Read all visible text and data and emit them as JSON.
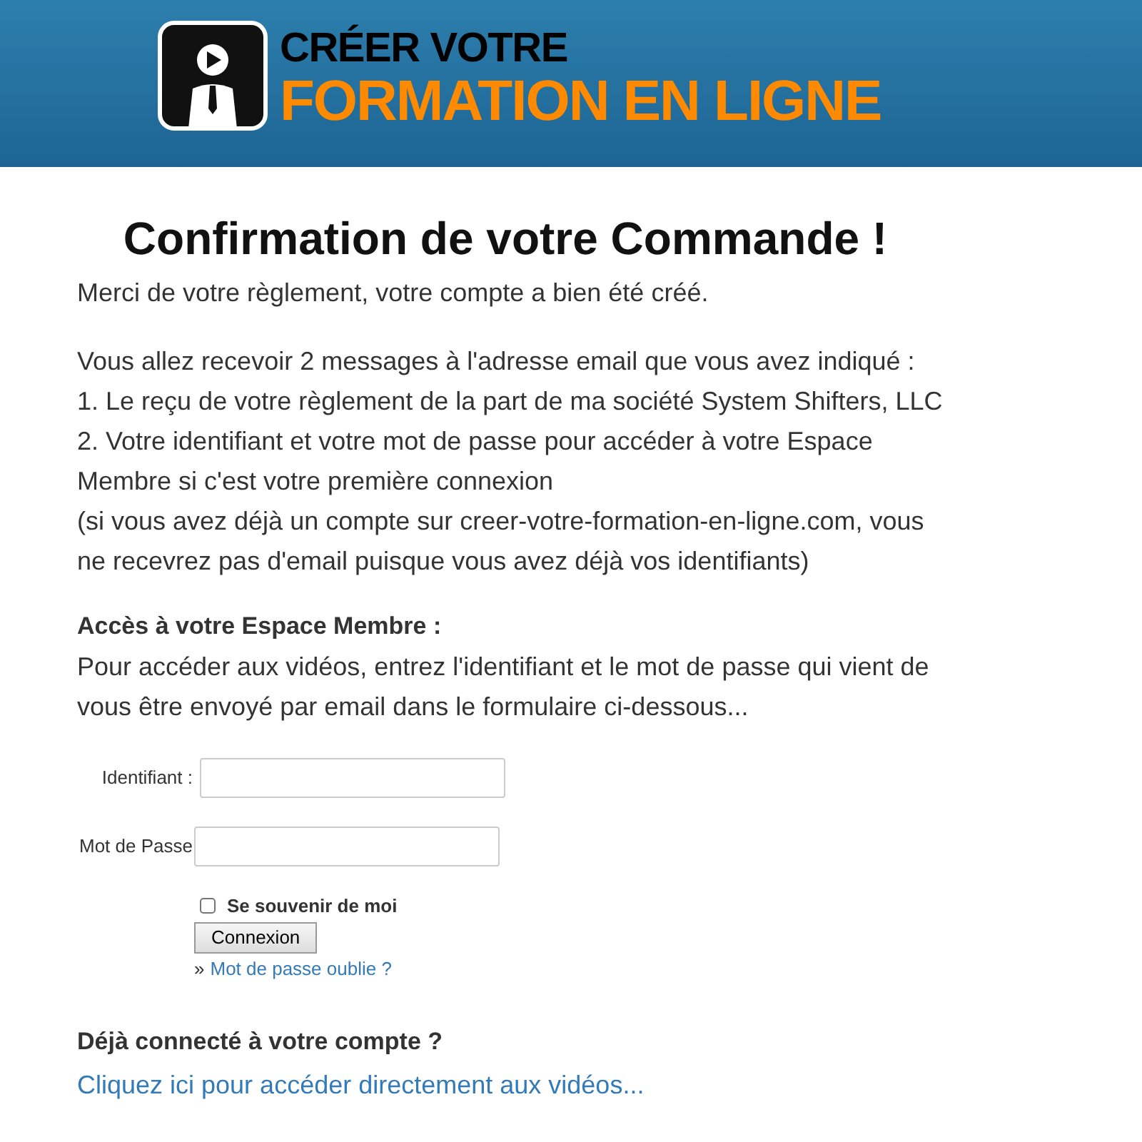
{
  "banner": {
    "line_1": "CRÉER VOTRE",
    "line_2": "FORMATION EN LIGNE"
  },
  "title": "Confirmation de votre Commande !",
  "intro": "Merci de votre règlement, votre compte a bien été créé.",
  "messages": [
    "Vous allez recevoir 2 messages à l'adresse email que vous avez indiqué :",
    "1. Le reçu de votre règlement de la part de ma société System Shifters, LLC",
    "2. Votre identifiant et votre mot de passe pour accéder à votre Espace Membre si c'est votre première connexion",
    "(si vous avez déjà un compte sur creer-votre-formation-en-ligne.com, vous ne recevrez pas d'email puisque vous avez déjà vos identifiants)"
  ],
  "access": {
    "heading": "Accès à votre Espace Membre :",
    "text": "Pour accéder aux vidéos, entrez l'identifiant et le mot de passe qui vient de vous être envoyé par email dans le formulaire ci-dessous..."
  },
  "login": {
    "fields": [
      {
        "label": "Identifiant :"
      },
      {
        "label": "Mot de Passe"
      }
    ],
    "remember": {
      "label": "Se souvenir de moi",
      "checked": false
    },
    "button": "Connexion",
    "forgot_prefix": "»",
    "forgot_link": "Mot de passe oublie ?"
  },
  "connected": {
    "heading": "Déjà connecté à votre compte ?",
    "link": "Cliquez ici pour accéder directement aux vidéos..."
  }
}
